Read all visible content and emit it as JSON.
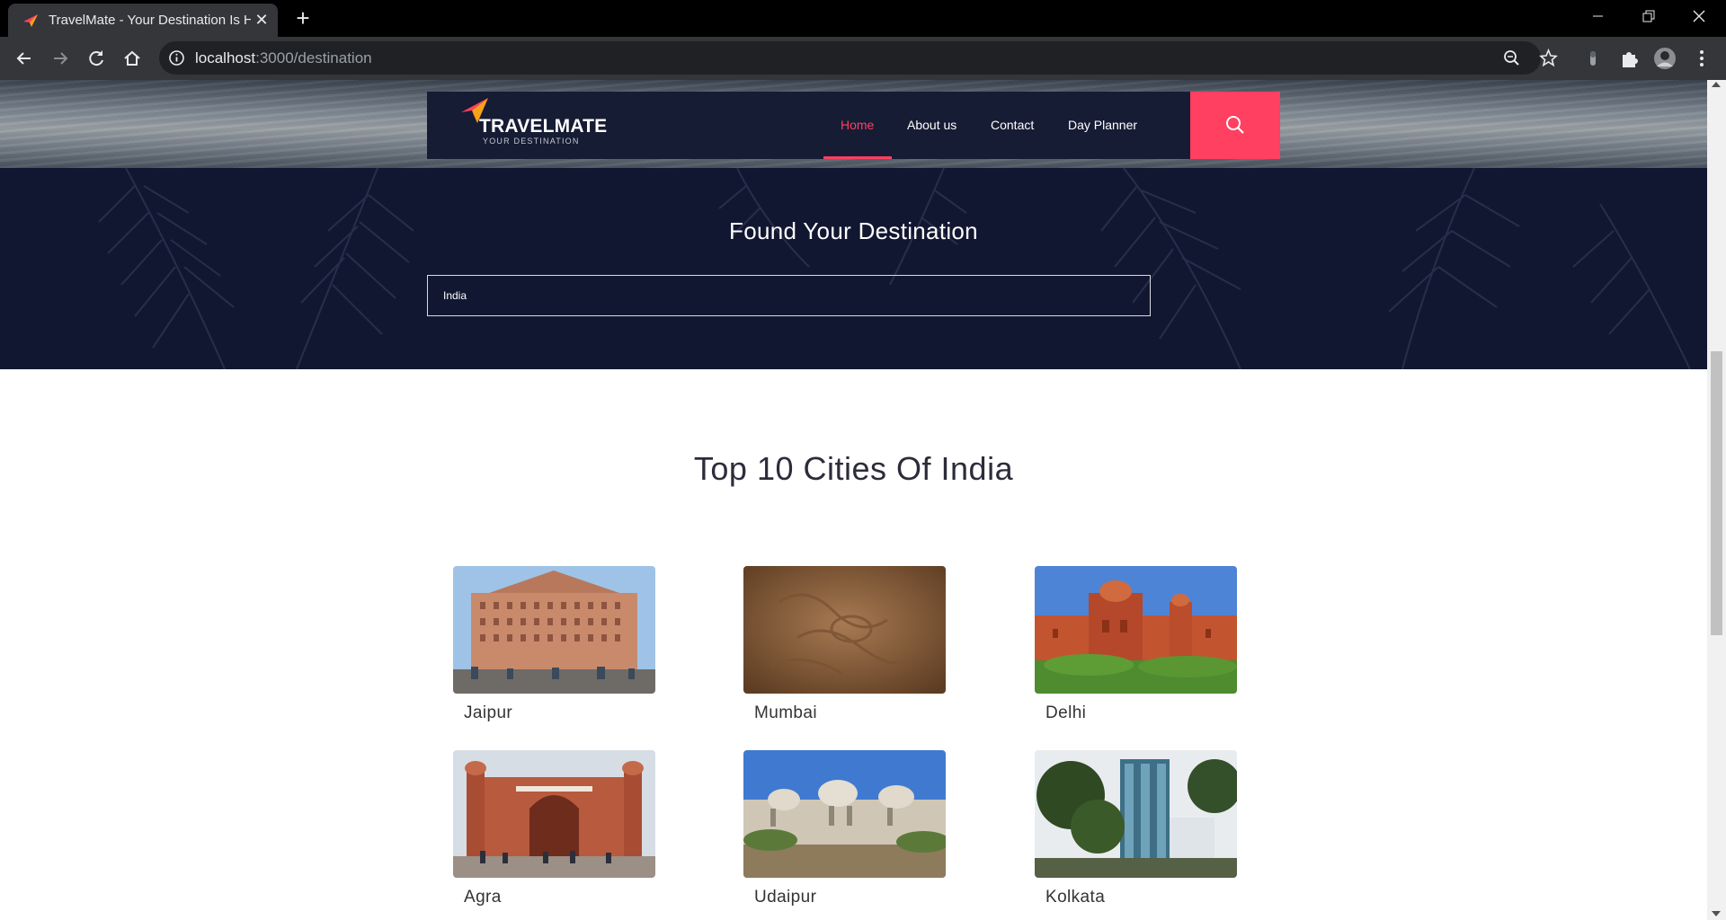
{
  "browser": {
    "tab_title": "TravelMate - Your Destination Is Here",
    "url_host": "localhost",
    "url_path": ":3000/destination"
  },
  "site": {
    "logo_name": "TRAVELMATE",
    "logo_tagline": "YOUR DESTINATION",
    "nav": [
      "Home",
      "About us",
      "Contact",
      "Day Planner"
    ],
    "active_nav": "Home",
    "accent_color": "#ff4060",
    "navbar_color": "#161c34"
  },
  "banner": {
    "title": "Found Your Destination",
    "search_value": "India"
  },
  "section": {
    "title": "Top 10 Cities Of India"
  },
  "cities": [
    {
      "name": "Jaipur"
    },
    {
      "name": "Mumbai"
    },
    {
      "name": "Delhi"
    },
    {
      "name": "Agra"
    },
    {
      "name": "Udaipur"
    },
    {
      "name": "Kolkata"
    }
  ]
}
